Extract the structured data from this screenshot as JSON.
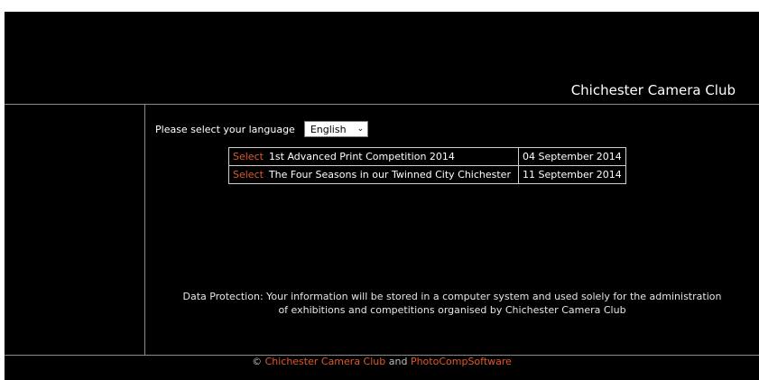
{
  "header": {
    "title": "Chichester Camera Club"
  },
  "language": {
    "prompt": "Please select your language",
    "selected": "English"
  },
  "competitions": [
    {
      "action": "Select",
      "name": "1st Advanced Print Competition 2014",
      "date": "04 September 2014"
    },
    {
      "action": "Select",
      "name": "The Four Seasons in our Twinned City Chichester",
      "date": "11 September 2014"
    }
  ],
  "notice": {
    "line1": "Data Protection: Your information will be stored in a computer system and used solely for the administration",
    "line2": "of exhibitions and competitions organised by Chichester Camera Club"
  },
  "footer": {
    "copyright": "©",
    "club_link": "Chichester Camera Club",
    "conjunction": "and",
    "software_link": "PhotoCompSoftware"
  },
  "colors": {
    "background": "#000000",
    "link_accent": "#e05a2b",
    "divider": "#8a8a8a"
  }
}
